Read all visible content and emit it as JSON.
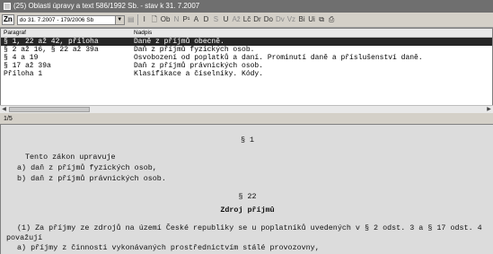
{
  "title": "(25) Oblasti úpravy a text 586/1992 Sb. - stav k 31. 7.2007",
  "toolbar": {
    "zn_label": "Zn",
    "version_value": "do 31. 7.2007 - 179/2006 Sb",
    "buttons": [
      "I",
      "Ob",
      "N",
      "P¹",
      "A",
      "D",
      "S",
      "U",
      "Až",
      "Lč",
      "Dr",
      "Do",
      "Dv",
      "Vz",
      "Bi",
      "Ui"
    ]
  },
  "list": {
    "col_paragraf": "Paragraf",
    "col_nadpis": "Nadpis",
    "rows": [
      {
        "paragraf": "§ 1, 22 až 42, příloha",
        "nadpis": "Daně z příjmů obecně.",
        "selected": true
      },
      {
        "paragraf": "§ 2 až 16, § 22 až 39a",
        "nadpis": "Daň z příjmů fyzických osob."
      },
      {
        "paragraf": "§ 4 a 19",
        "nadpis": "Osvobození od poplatků a daní. Prominutí daně a příslušenství daně."
      },
      {
        "paragraf": "§ 17 až 39a",
        "nadpis": "Daň z příjmů právnických osob."
      },
      {
        "paragraf": "Příloha 1",
        "nadpis": "Klasifikace a číselníky. Kódy."
      }
    ]
  },
  "status": "1/5",
  "document": {
    "sec1": "§ 1",
    "intro": "Tento zákon upravuje",
    "item_a": "a) daň z příjmů fyzických osob,",
    "item_b": "b) daň z příjmů právnických osob.",
    "sec22": "§ 22",
    "heading": "Zdroj příjmů",
    "para1_line1": "(1) Za příjmy ze zdrojů na území České republiky se u poplatníků uvedených v § 2 odst. 3 a § 17 odst. 4",
    "para1_line2": "považují",
    "para1_a": "a) příjmy z činnosti vykonávaných prostřednictvím stálé provozovny,"
  }
}
